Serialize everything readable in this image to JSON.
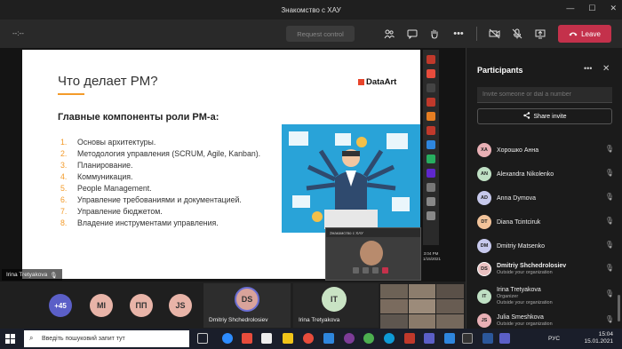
{
  "window": {
    "title": "Знакомство с ХАУ",
    "minimize": "—",
    "maximize": "☐",
    "close": "✕"
  },
  "toolbar": {
    "timer": "--:--",
    "request_control": "Request control",
    "leave_label": "Leave",
    "icons": [
      "people-icon",
      "chat-icon",
      "raise-hand-icon",
      "more-icon",
      "camera-off-icon",
      "mic-off-icon",
      "share-icon",
      "phone-icon"
    ]
  },
  "slide": {
    "title": "Что делает PM?",
    "logo": "DataArt",
    "subtitle": "Главные компоненты роли PM-а:",
    "items": [
      {
        "num": "1.",
        "text": "Основы архитектуры."
      },
      {
        "num": "2.",
        "text": "Методология управления (SCRUM, Agile, Kanban)."
      },
      {
        "num": "3.",
        "text": "Планирование."
      },
      {
        "num": "4.",
        "text": "Коммуникация."
      },
      {
        "num": "5.",
        "text": "People Management."
      },
      {
        "num": "6.",
        "text": "Управление требованиями и документацией."
      },
      {
        "num": "7.",
        "text": "Управление бюджетом."
      },
      {
        "num": "8.",
        "text": "Владение инструментами управления."
      }
    ]
  },
  "mini_window": {
    "title": "Знакомство с ХАУ",
    "time": "3:04 PM",
    "date": "1/15/2021"
  },
  "presenter": {
    "name": "Irina Tretyakova"
  },
  "gallery": {
    "overflow": "+45",
    "avatars": [
      {
        "initials": "MI",
        "color": "#e8b4a8"
      },
      {
        "initials": "ПП",
        "color": "#e8b4a8"
      },
      {
        "initials": "JS",
        "color": "#e8b4a8"
      }
    ],
    "dmitriy": {
      "initials": "DS",
      "name": "Dmitriy Shchedrolosiev",
      "color": "#d9a39b"
    },
    "irina": {
      "initials": "IT",
      "name": "Irina Tretyakova",
      "color": "#c9e3c4"
    }
  },
  "panel": {
    "title": "Participants",
    "invite_placeholder": "Invite someone or dial a number",
    "share_invite": "Share invite",
    "participants": [
      {
        "initials": "ХА",
        "name": "Хорошко Анна",
        "sub": "",
        "color": "#e9b0b5"
      },
      {
        "initials": "AN",
        "name": "Alexandra Nikolenko",
        "sub": "",
        "color": "#bfe0c4"
      },
      {
        "initials": "AD",
        "name": "Anna Dymova",
        "sub": "",
        "color": "#c7c9ec"
      },
      {
        "initials": "DT",
        "name": "Diana Tcintciruk",
        "sub": "",
        "color": "#f2c39a"
      },
      {
        "initials": "DM",
        "name": "Dmitriy Matsenko",
        "sub": "",
        "color": "#c7c9ec"
      },
      {
        "initials": "DS",
        "name": "Dmitriy Shchedrolosiev",
        "sub": "Outside your organization",
        "color": "#e9c0c0"
      },
      {
        "initials": "IT",
        "name": "Irina Tretyakova",
        "sub": "Organizer\nOutside your organization",
        "color": "#bfe0c4"
      },
      {
        "initials": "JS",
        "name": "Julia Smeshkova",
        "sub": "Outside your organization",
        "color": "#e9b0b5"
      }
    ]
  },
  "taskbar": {
    "search_placeholder": "Введіть пошуковий запит тут",
    "lang": "РУС",
    "time": "15:04",
    "date": "15.01.2021"
  }
}
